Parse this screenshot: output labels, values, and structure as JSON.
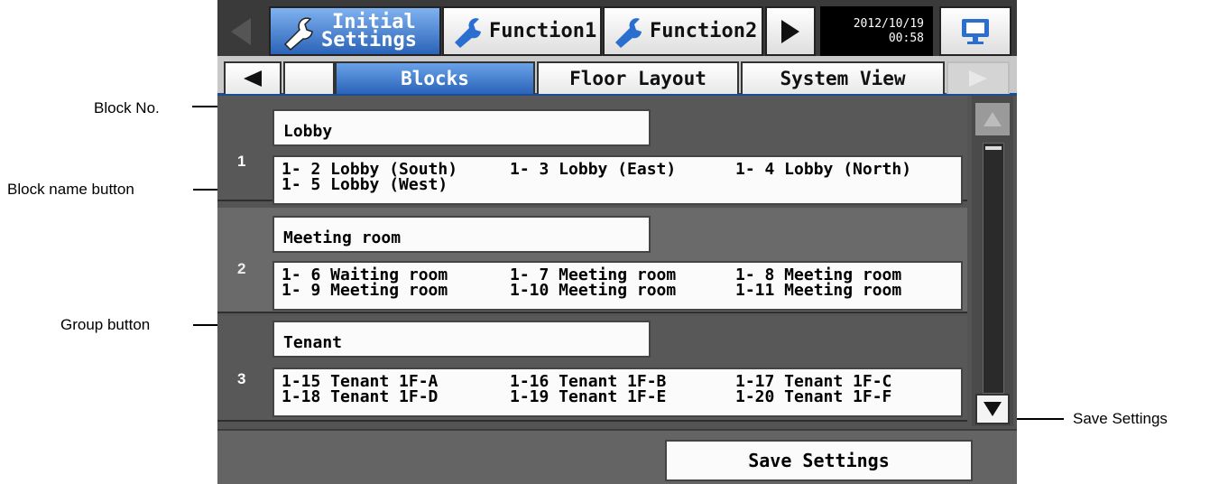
{
  "callouts": {
    "block_no": "Block No.",
    "block_name_button": "Block name button",
    "group_button": "Group button",
    "save_settings": "Save Settings"
  },
  "header": {
    "tabs": [
      {
        "label_line1": "Initial",
        "label_line2": "Settings",
        "icon": "wrench-icon",
        "active": true
      },
      {
        "label": "Function1",
        "icon": "wrench-icon"
      },
      {
        "label": "Function2",
        "icon": "wrench-icon"
      }
    ],
    "date": "2012/10/19",
    "time": "00:58",
    "monitor_icon": "monitor-icon"
  },
  "subtabs": [
    "",
    "Blocks",
    "Floor Layout",
    "System View"
  ],
  "active_subtab": "Blocks",
  "blocks": [
    {
      "number": "1",
      "name": "Lobby",
      "groups": [
        [
          "1- 2 Lobby (South)",
          "1- 3 Lobby (East)",
          "1- 4 Lobby (North)"
        ],
        [
          "1- 5 Lobby (West)",
          "",
          ""
        ]
      ]
    },
    {
      "number": "2",
      "name": "Meeting room",
      "groups": [
        [
          "1- 6 Waiting room",
          "1- 7 Meeting room",
          "1- 8 Meeting room"
        ],
        [
          "1- 9 Meeting room",
          "1-10 Meeting room",
          "1-11 Meeting room"
        ]
      ]
    },
    {
      "number": "3",
      "name": "Tenant",
      "groups": [
        [
          "1-15 Tenant 1F-A",
          "1-16 Tenant 1F-B",
          "1-17 Tenant 1F-C"
        ],
        [
          "1-18 Tenant 1F-D",
          "1-19 Tenant 1F-E",
          "1-20 Tenant 1F-F"
        ]
      ]
    }
  ],
  "footer": {
    "save_label": "Save Settings"
  },
  "colors": {
    "accent_blue": "#2a63b8",
    "panel_dark": "#545454",
    "button_face": "#fbfbfb"
  }
}
